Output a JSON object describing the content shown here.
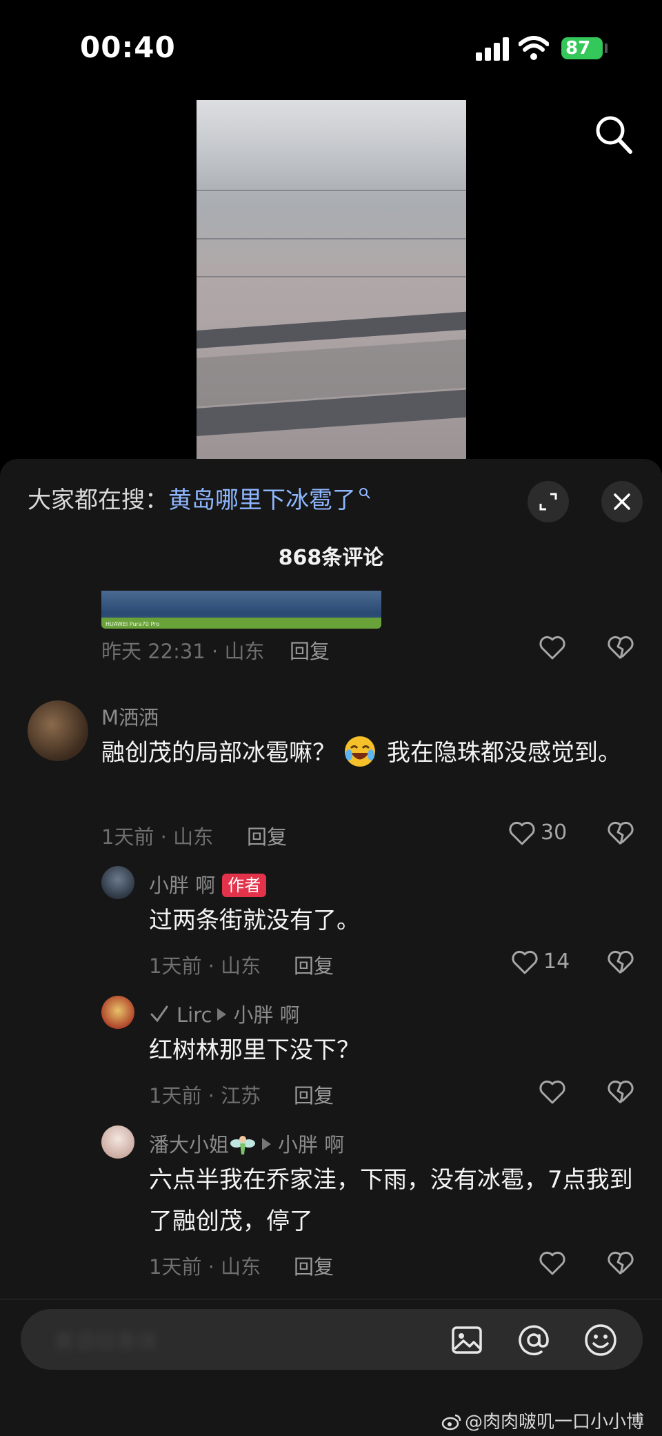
{
  "status_bar": {
    "time": "00:40",
    "battery": "87"
  },
  "trending": {
    "prefix": "大家都在搜：",
    "term": "黄岛哪里下冰雹了"
  },
  "comments_header": {
    "count_label": "868条评论"
  },
  "prev_comment": {
    "image_caption": "HUAWEI Pura70 Pro",
    "meta": "昨天 22:31 · 山东",
    "reply_label": "回复"
  },
  "comments": [
    {
      "username": "M洒洒",
      "text_before_emoji": "融创茂的局部冰雹嘛？",
      "emoji": "laughing-crying-face",
      "text_after_emoji": "我在隐珠都没感觉到。",
      "meta": "1天前 · 山东",
      "reply_label": "回复",
      "likes": "30"
    },
    {
      "username": "小胖 啊",
      "badge": "作者",
      "text": "过两条街就没有了。",
      "meta": "1天前 · 山东",
      "reply_label": "回复",
      "likes": "14"
    },
    {
      "username": "Lirc",
      "reply_to": "小胖 啊",
      "text": "红树林那里下没下？",
      "meta": "1天前 · 江苏",
      "reply_label": "回复"
    },
    {
      "username": "潘大小姐",
      "reply_to": "小胖 啊",
      "text": "六点半我在乔家洼，下雨，没有冰雹，7点我到了融创茂，停了",
      "meta": "1天前 · 山东",
      "reply_label": "回复"
    }
  ],
  "input": {
    "placeholder": "善语结善缘"
  },
  "watermark": "@肉肉啵叽一口小小博"
}
